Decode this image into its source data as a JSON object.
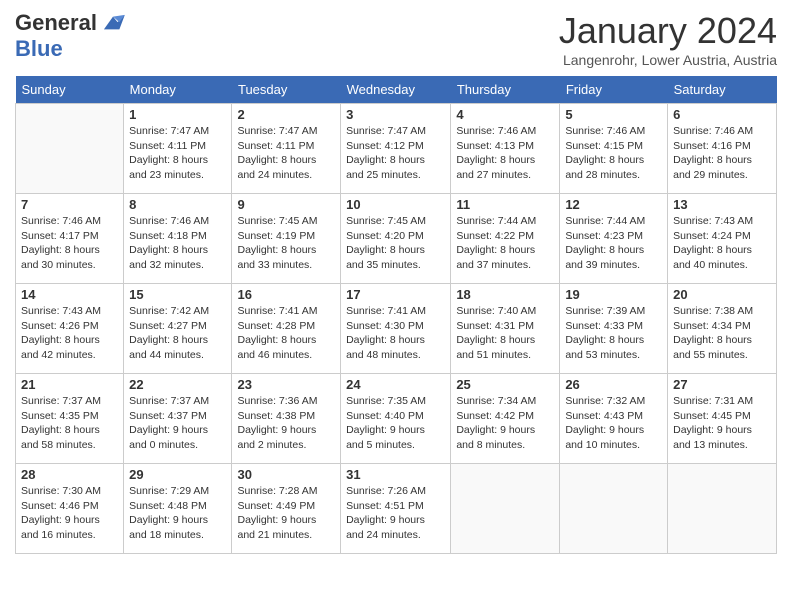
{
  "header": {
    "logo_general": "General",
    "logo_blue": "Blue",
    "month_title": "January 2024",
    "location": "Langenrohr, Lower Austria, Austria"
  },
  "days_of_week": [
    "Sunday",
    "Monday",
    "Tuesday",
    "Wednesday",
    "Thursday",
    "Friday",
    "Saturday"
  ],
  "weeks": [
    [
      {
        "day": "",
        "info": ""
      },
      {
        "day": "1",
        "info": "Sunrise: 7:47 AM\nSunset: 4:11 PM\nDaylight: 8 hours\nand 23 minutes."
      },
      {
        "day": "2",
        "info": "Sunrise: 7:47 AM\nSunset: 4:11 PM\nDaylight: 8 hours\nand 24 minutes."
      },
      {
        "day": "3",
        "info": "Sunrise: 7:47 AM\nSunset: 4:12 PM\nDaylight: 8 hours\nand 25 minutes."
      },
      {
        "day": "4",
        "info": "Sunrise: 7:46 AM\nSunset: 4:13 PM\nDaylight: 8 hours\nand 27 minutes."
      },
      {
        "day": "5",
        "info": "Sunrise: 7:46 AM\nSunset: 4:15 PM\nDaylight: 8 hours\nand 28 minutes."
      },
      {
        "day": "6",
        "info": "Sunrise: 7:46 AM\nSunset: 4:16 PM\nDaylight: 8 hours\nand 29 minutes."
      }
    ],
    [
      {
        "day": "7",
        "info": "Sunrise: 7:46 AM\nSunset: 4:17 PM\nDaylight: 8 hours\nand 30 minutes."
      },
      {
        "day": "8",
        "info": "Sunrise: 7:46 AM\nSunset: 4:18 PM\nDaylight: 8 hours\nand 32 minutes."
      },
      {
        "day": "9",
        "info": "Sunrise: 7:45 AM\nSunset: 4:19 PM\nDaylight: 8 hours\nand 33 minutes."
      },
      {
        "day": "10",
        "info": "Sunrise: 7:45 AM\nSunset: 4:20 PM\nDaylight: 8 hours\nand 35 minutes."
      },
      {
        "day": "11",
        "info": "Sunrise: 7:44 AM\nSunset: 4:22 PM\nDaylight: 8 hours\nand 37 minutes."
      },
      {
        "day": "12",
        "info": "Sunrise: 7:44 AM\nSunset: 4:23 PM\nDaylight: 8 hours\nand 39 minutes."
      },
      {
        "day": "13",
        "info": "Sunrise: 7:43 AM\nSunset: 4:24 PM\nDaylight: 8 hours\nand 40 minutes."
      }
    ],
    [
      {
        "day": "14",
        "info": "Sunrise: 7:43 AM\nSunset: 4:26 PM\nDaylight: 8 hours\nand 42 minutes."
      },
      {
        "day": "15",
        "info": "Sunrise: 7:42 AM\nSunset: 4:27 PM\nDaylight: 8 hours\nand 44 minutes."
      },
      {
        "day": "16",
        "info": "Sunrise: 7:41 AM\nSunset: 4:28 PM\nDaylight: 8 hours\nand 46 minutes."
      },
      {
        "day": "17",
        "info": "Sunrise: 7:41 AM\nSunset: 4:30 PM\nDaylight: 8 hours\nand 48 minutes."
      },
      {
        "day": "18",
        "info": "Sunrise: 7:40 AM\nSunset: 4:31 PM\nDaylight: 8 hours\nand 51 minutes."
      },
      {
        "day": "19",
        "info": "Sunrise: 7:39 AM\nSunset: 4:33 PM\nDaylight: 8 hours\nand 53 minutes."
      },
      {
        "day": "20",
        "info": "Sunrise: 7:38 AM\nSunset: 4:34 PM\nDaylight: 8 hours\nand 55 minutes."
      }
    ],
    [
      {
        "day": "21",
        "info": "Sunrise: 7:37 AM\nSunset: 4:35 PM\nDaylight: 8 hours\nand 58 minutes."
      },
      {
        "day": "22",
        "info": "Sunrise: 7:37 AM\nSunset: 4:37 PM\nDaylight: 9 hours\nand 0 minutes."
      },
      {
        "day": "23",
        "info": "Sunrise: 7:36 AM\nSunset: 4:38 PM\nDaylight: 9 hours\nand 2 minutes."
      },
      {
        "day": "24",
        "info": "Sunrise: 7:35 AM\nSunset: 4:40 PM\nDaylight: 9 hours\nand 5 minutes."
      },
      {
        "day": "25",
        "info": "Sunrise: 7:34 AM\nSunset: 4:42 PM\nDaylight: 9 hours\nand 8 minutes."
      },
      {
        "day": "26",
        "info": "Sunrise: 7:32 AM\nSunset: 4:43 PM\nDaylight: 9 hours\nand 10 minutes."
      },
      {
        "day": "27",
        "info": "Sunrise: 7:31 AM\nSunset: 4:45 PM\nDaylight: 9 hours\nand 13 minutes."
      }
    ],
    [
      {
        "day": "28",
        "info": "Sunrise: 7:30 AM\nSunset: 4:46 PM\nDaylight: 9 hours\nand 16 minutes."
      },
      {
        "day": "29",
        "info": "Sunrise: 7:29 AM\nSunset: 4:48 PM\nDaylight: 9 hours\nand 18 minutes."
      },
      {
        "day": "30",
        "info": "Sunrise: 7:28 AM\nSunset: 4:49 PM\nDaylight: 9 hours\nand 21 minutes."
      },
      {
        "day": "31",
        "info": "Sunrise: 7:26 AM\nSunset: 4:51 PM\nDaylight: 9 hours\nand 24 minutes."
      },
      {
        "day": "",
        "info": ""
      },
      {
        "day": "",
        "info": ""
      },
      {
        "day": "",
        "info": ""
      }
    ]
  ]
}
